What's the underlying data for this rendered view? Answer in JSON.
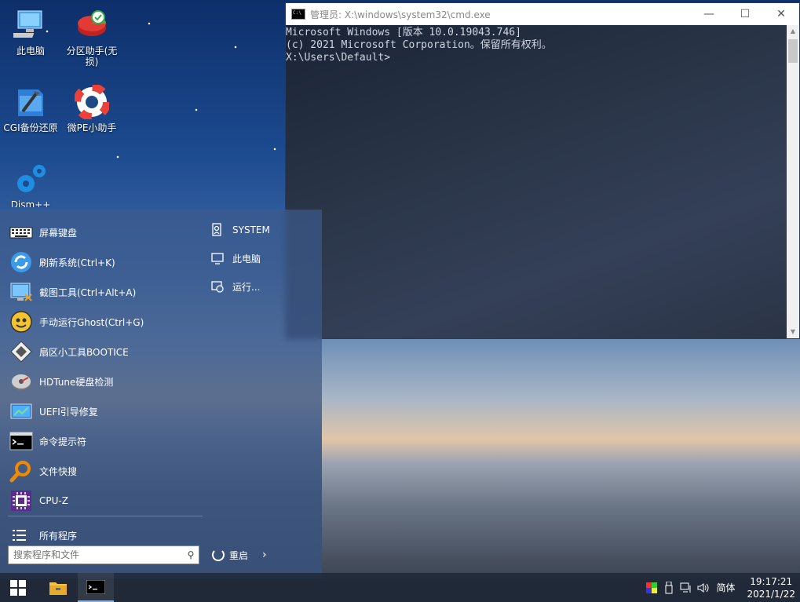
{
  "desktop": {
    "icons": [
      {
        "label": "此电脑",
        "icon": "computer-icon"
      },
      {
        "label": "分区助手(无损)",
        "icon": "partition-assistant-icon"
      },
      {
        "label": "CGI备份还原",
        "icon": "cgi-backup-icon"
      },
      {
        "label": "微PE小助手",
        "icon": "lifebuoy-icon"
      },
      {
        "label": "Dism++",
        "icon": "dism-gears-icon"
      }
    ]
  },
  "cmd_window": {
    "title": "管理员: X:\\windows\\system32\\cmd.exe",
    "lines": [
      "Microsoft Windows [版本 10.0.19043.746]",
      "(c) 2021 Microsoft Corporation。保留所有权利。",
      "",
      "X:\\Users\\Default>"
    ],
    "controls": {
      "minimize": "—",
      "maximize": "☐",
      "close": "✕"
    }
  },
  "start_menu": {
    "items": [
      {
        "label": "屏幕键盘",
        "icon": "keyboard-icon"
      },
      {
        "label": "刷新系统(Ctrl+K)",
        "icon": "refresh-icon"
      },
      {
        "label": "截图工具(Ctrl+Alt+A)",
        "icon": "screenshot-icon"
      },
      {
        "label": "手动运行Ghost(Ctrl+G)",
        "icon": "ghost-icon"
      },
      {
        "label": "扇区小工具BOOTICE",
        "icon": "bootice-icon"
      },
      {
        "label": "HDTune硬盘检测",
        "icon": "hdtune-icon"
      },
      {
        "label": "UEFI引导修复",
        "icon": "uefi-repair-icon"
      },
      {
        "label": "命令提示符",
        "icon": "cmd-icon"
      },
      {
        "label": "文件快搜",
        "icon": "magnifier-icon"
      },
      {
        "label": "CPU-Z",
        "icon": "cpuz-icon"
      }
    ],
    "all_programs": "所有程序",
    "right_items": [
      {
        "label": "SYSTEM",
        "icon": "user-icon"
      },
      {
        "label": "此电脑",
        "icon": "monitor-icon"
      },
      {
        "label": "运行...",
        "icon": "run-icon"
      }
    ],
    "search_placeholder": "搜索程序和文件",
    "restart_label": "重启"
  },
  "taskbar": {
    "tray_language": "简体",
    "time": "19:17:21",
    "date": "2021/1/22"
  }
}
